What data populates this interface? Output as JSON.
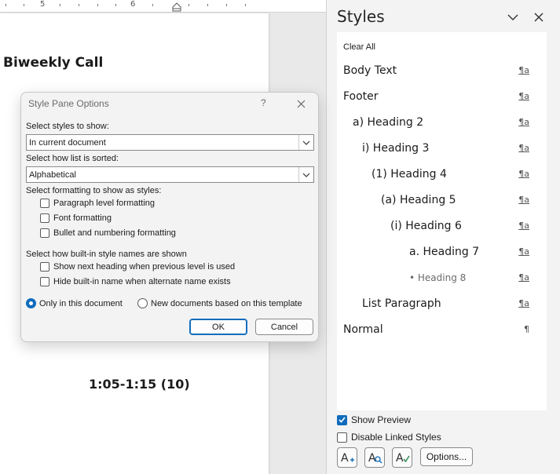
{
  "ruler": {
    "numbers": [
      "5",
      "6"
    ]
  },
  "document": {
    "heading": "Biweekly Call",
    "time_text": "1:05-1:15 (10)"
  },
  "styles_pane": {
    "title": "Styles",
    "clear_all": "Clear All",
    "styles": [
      {
        "label": "Body Text",
        "mark": "¶a"
      },
      {
        "label": "Footer",
        "mark": "¶a"
      },
      {
        "label": "a)  Heading 2",
        "mark": "¶a"
      },
      {
        "label": "i)  Heading 3",
        "mark": "¶a"
      },
      {
        "label": "(1)  Heading 4",
        "mark": "¶a"
      },
      {
        "label": "(a)  Heading 5",
        "mark": "¶a"
      },
      {
        "label": "(i)  Heading 6",
        "mark": "¶a"
      },
      {
        "label": "a.  Heading 7",
        "mark": "¶a"
      },
      {
        "label": "•  Heading 8",
        "mark": "¶a"
      },
      {
        "label": "List Paragraph",
        "mark": "¶a"
      },
      {
        "label": "Normal",
        "mark": "¶"
      }
    ],
    "show_preview": {
      "label": "Show Preview",
      "checked": true
    },
    "disable_linked": {
      "label": "Disable Linked Styles",
      "checked": false
    },
    "options_label": "Options..."
  },
  "dialog": {
    "title": "Style Pane Options",
    "help": "?",
    "select_styles_label": "Select styles to show:",
    "select_styles_value": "In current document",
    "sort_label": "Select how list is sorted:",
    "sort_value": "Alphabetical",
    "formatting_label": "Select formatting to show as styles:",
    "formatting_options": [
      {
        "label": "Paragraph level formatting",
        "checked": false
      },
      {
        "label": "Font formatting",
        "checked": false
      },
      {
        "label": "Bullet and numbering formatting",
        "checked": false
      }
    ],
    "builtin_label": "Select how built-in style names are shown",
    "builtin_options": [
      {
        "label": "Show next heading when previous level is used",
        "checked": false
      },
      {
        "label": "Hide built-in name when alternate name exists",
        "checked": false
      }
    ],
    "scope_options": [
      {
        "label": "Only in this document",
        "selected": true
      },
      {
        "label": "New documents based on this template",
        "selected": false
      }
    ],
    "ok_label": "OK",
    "cancel_label": "Cancel"
  },
  "colors": {
    "accent": "#0f6cbd"
  }
}
